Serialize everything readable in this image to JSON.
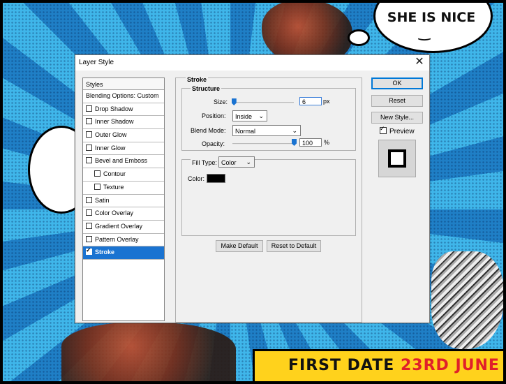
{
  "background": {
    "bubble_top": "SHE IS NICE",
    "bubble_face": "‿",
    "banner": {
      "part1": "FIRST DATE ",
      "part2": "23RD",
      "part3": " JUNE"
    }
  },
  "dialog": {
    "title": "Layer Style",
    "close_icon": "✕",
    "styles_header": "Styles",
    "blending_options": "Blending Options: Custom",
    "effects": [
      {
        "label": "Drop Shadow",
        "checked": false
      },
      {
        "label": "Inner Shadow",
        "checked": false
      },
      {
        "label": "Outer Glow",
        "checked": false
      },
      {
        "label": "Inner Glow",
        "checked": false
      },
      {
        "label": "Bevel and Emboss",
        "checked": false
      },
      {
        "label": "Contour",
        "checked": false
      },
      {
        "label": "Texture",
        "checked": false
      },
      {
        "label": "Satin",
        "checked": false
      },
      {
        "label": "Color Overlay",
        "checked": false
      },
      {
        "label": "Gradient Overlay",
        "checked": false
      },
      {
        "label": "Pattern Overlay",
        "checked": false
      },
      {
        "label": "Stroke",
        "checked": true
      }
    ],
    "stroke": {
      "section_title": "Stroke",
      "structure_title": "Structure",
      "size_label": "Size:",
      "size_value": "6",
      "size_unit": "px",
      "size_fraction": 0.02,
      "position_label": "Position:",
      "position_value": "Inside",
      "blend_mode_label": "Blend Mode:",
      "blend_mode_value": "Normal",
      "opacity_label": "Opacity:",
      "opacity_value": "100",
      "opacity_unit": "%",
      "opacity_fraction": 1.0,
      "fill_type_label": "Fill Type:",
      "fill_type_value": "Color",
      "color_label": "Color:",
      "color_value": "#000000",
      "make_default": "Make Default",
      "reset_default": "Reset to Default"
    },
    "buttons": {
      "ok": "OK",
      "reset": "Reset",
      "new_style": "New Style...",
      "preview_label": "Preview",
      "preview_checked": true
    },
    "accent_color": "#1a73d1"
  }
}
